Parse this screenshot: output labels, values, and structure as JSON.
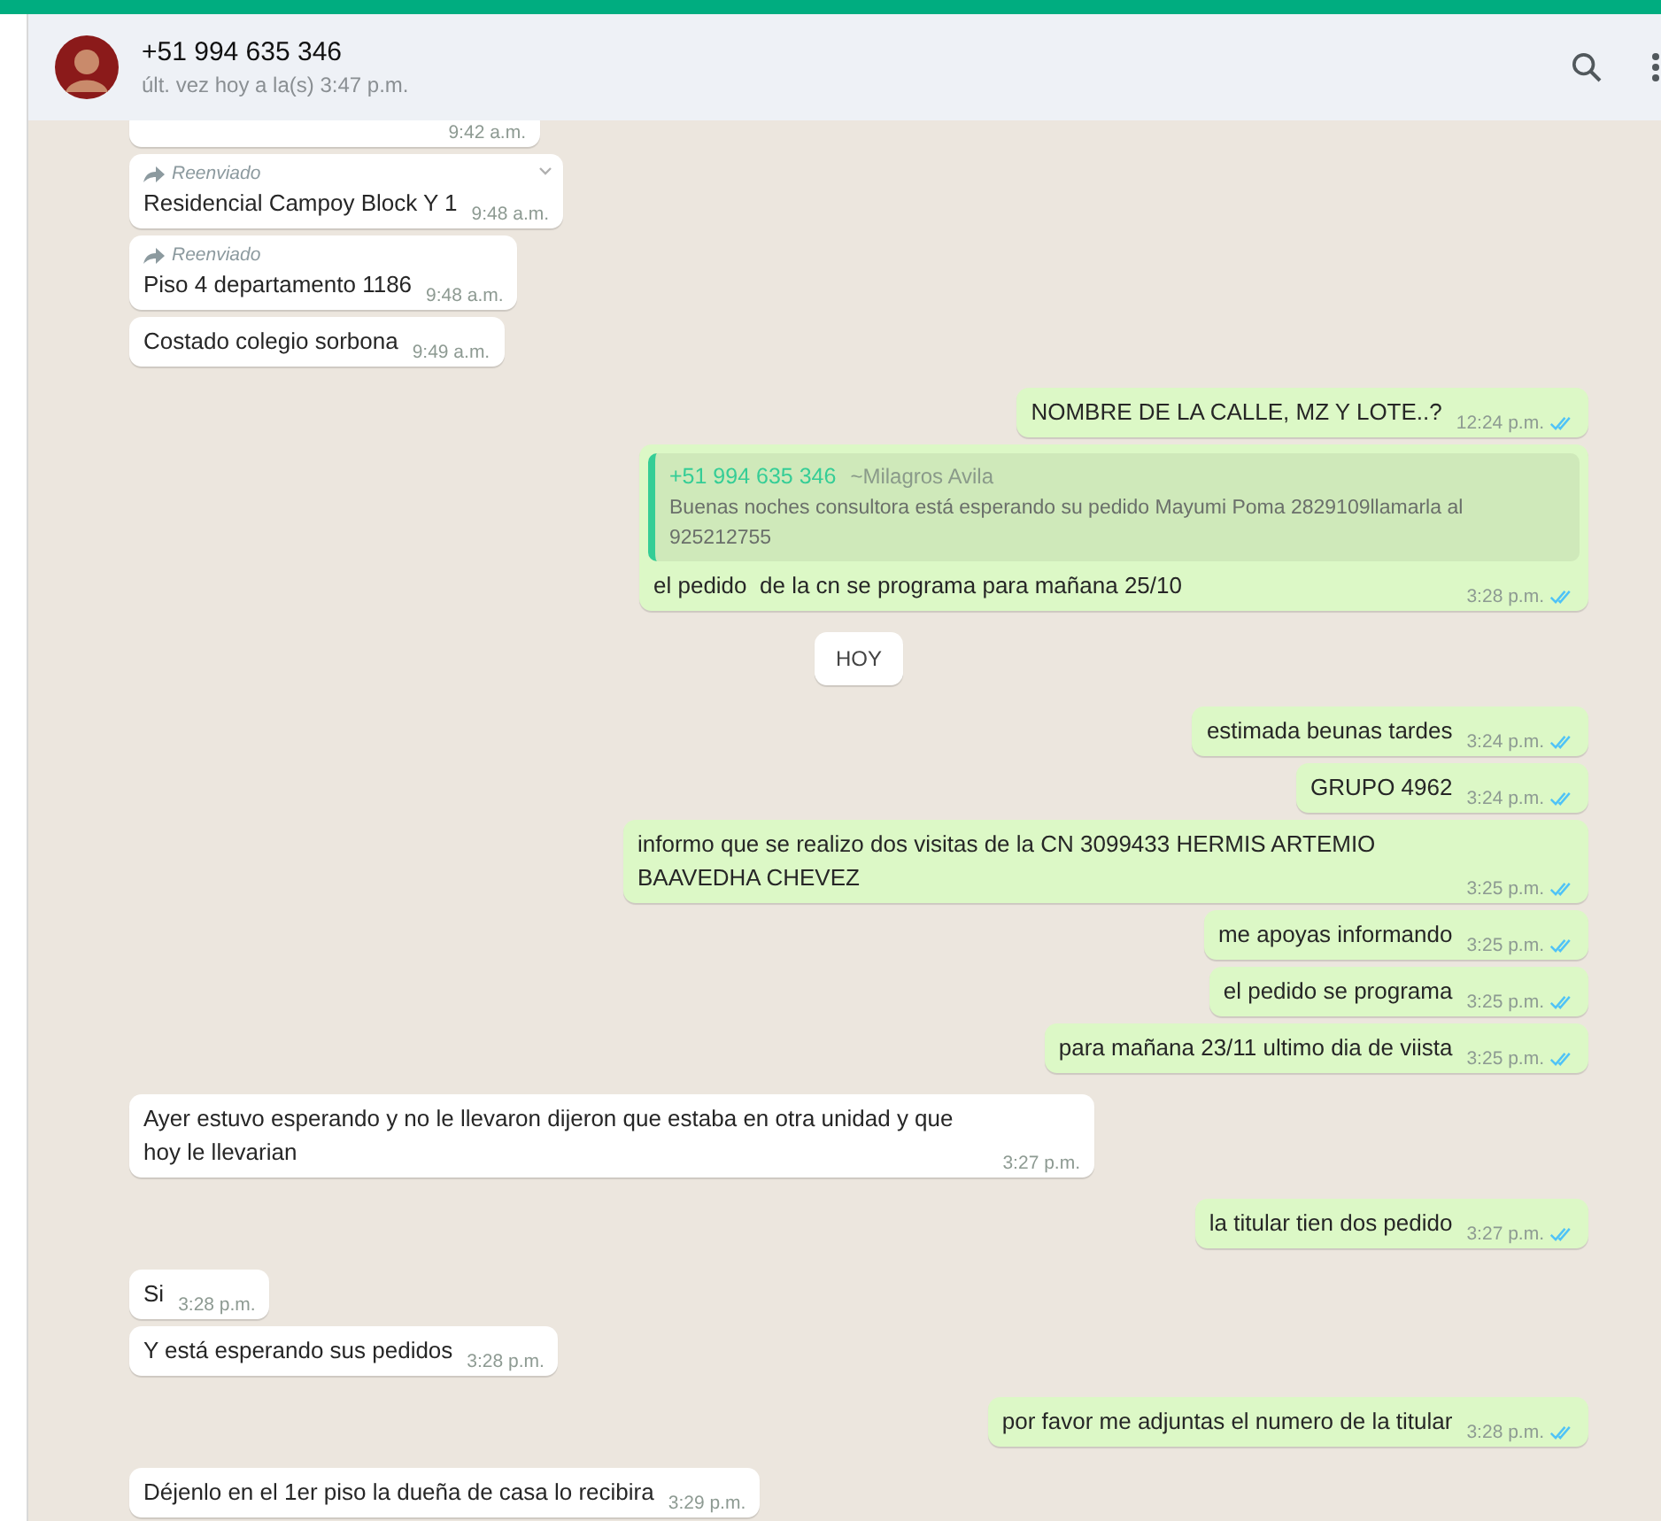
{
  "contact": {
    "name": "+51 994 635 346",
    "last_seen": "últ. vez hoy a la(s) 3:47 p.m."
  },
  "messages": [
    {
      "kind": "incoming",
      "time": "9:42 a.m."
    },
    {
      "kind": "incoming",
      "forwarded_label": "Reenviado",
      "text": "Residencial Campoy Block Y 1",
      "time": "9:48 a.m.",
      "menu_shown": true
    },
    {
      "kind": "incoming",
      "forwarded_label": "Reenviado",
      "text": "Piso 4 departamento 1186",
      "time": "9:48 a.m."
    },
    {
      "kind": "incoming",
      "text": "Costado colegio sorbona",
      "time": "9:49 a.m."
    },
    {
      "kind": "outgoing",
      "text": "NOMBRE DE LA CALLE, MZ Y LOTE..?",
      "time": "12:24 p.m.",
      "read": true
    },
    {
      "kind": "outgoing",
      "quote": {
        "sender": "+51 994 635 346",
        "sender_name": "~Milagros Avila",
        "text": "Buenas noches consultora está esperando su pedido Mayumi Poma 2829109llamarla al 925212755"
      },
      "text": "el pedido  de la cn se programa para mañana 25/10",
      "time": "3:28 p.m.",
      "read": true
    },
    {
      "kind": "date",
      "text": "HOY"
    },
    {
      "kind": "outgoing",
      "text": "estimada beunas tardes",
      "time": "3:24 p.m.",
      "read": true
    },
    {
      "kind": "outgoing",
      "text": "GRUPO 4962",
      "time": "3:24 p.m.",
      "read": true
    },
    {
      "kind": "outgoing",
      "text": "informo que se realizo dos visitas de la CN 3099433 HERMIS ARTEMIO BAAVEDHA CHEVEZ",
      "time": "3:25 p.m.",
      "read": true
    },
    {
      "kind": "outgoing",
      "text": "me apoyas informando",
      "time": "3:25 p.m.",
      "read": true
    },
    {
      "kind": "outgoing",
      "text": "el pedido se programa",
      "time": "3:25 p.m.",
      "read": true
    },
    {
      "kind": "outgoing",
      "text": "para mañana 23/11 ultimo dia de viista",
      "time": "3:25 p.m.",
      "read": true
    },
    {
      "kind": "incoming",
      "text": "Ayer estuvo esperando y no le llevaron dijeron que estaba en otra unidad y que hoy le llevarian",
      "time": "3:27 p.m."
    },
    {
      "kind": "outgoing",
      "text": "la titular tien dos pedido",
      "time": "3:27 p.m.",
      "read": true
    },
    {
      "kind": "incoming",
      "text": "Si",
      "time": "3:28 p.m."
    },
    {
      "kind": "incoming",
      "text": "Y está esperando sus pedidos",
      "time": "3:28 p.m."
    },
    {
      "kind": "outgoing",
      "text": "por favor me adjuntas el numero de la titular",
      "time": "3:28 p.m.",
      "read": true
    },
    {
      "kind": "incoming",
      "text": "Déjenlo en el 1er piso la dueña de casa lo recibira",
      "time": "3:29 p.m."
    }
  ]
}
